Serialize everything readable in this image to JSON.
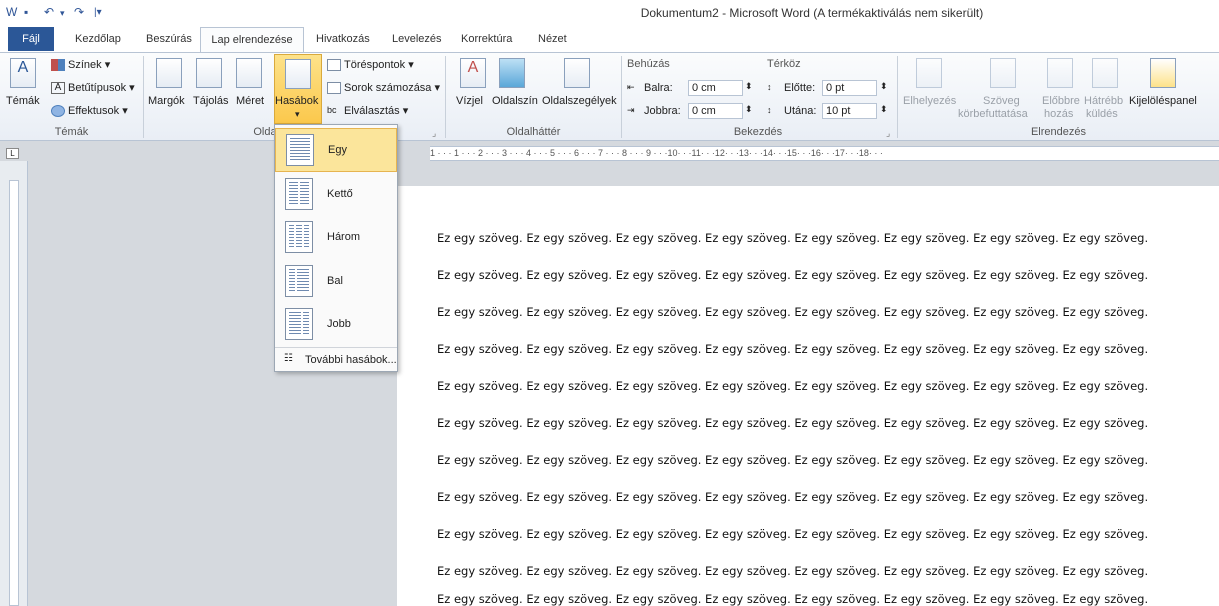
{
  "window": {
    "title": "Dokumentum2 - Microsoft Word (A termékaktiválás nem sikerült)"
  },
  "tabs": {
    "file": "Fájl",
    "home": "Kezdőlap",
    "insert": "Beszúrás",
    "layout": "Lap elrendezése",
    "references": "Hivatkozás",
    "mailings": "Levelezés",
    "review": "Korrektúra",
    "view": "Nézet"
  },
  "ribbon": {
    "themes": {
      "label": "Témák",
      "colors": "Színek",
      "fonts": "Betűtípusok",
      "effects": "Effektusok",
      "group": "Témák"
    },
    "pagesetup": {
      "margins": "Margók",
      "orientation": "Tájolás",
      "size": "Méret",
      "columns": "Hasábok",
      "breaks": "Töréspontok",
      "line_numbers": "Sorok számozása",
      "hyphenation": "Elválasztás",
      "group": "Olda"
    },
    "background": {
      "watermark": "Vízjel",
      "page_color": "Oldalszín",
      "page_borders": "Oldalszegélyek",
      "group": "Oldalháttér"
    },
    "paragraph": {
      "indent": "Behúzás",
      "left": "Balra:",
      "left_val": "0 cm",
      "right": "Jobbra:",
      "right_val": "0 cm",
      "spacing": "Térköz",
      "before": "Előtte:",
      "before_val": "0 pt",
      "after": "Utána:",
      "after_val": "10 pt",
      "group": "Bekezdés"
    },
    "arrange": {
      "position": "Elhelyezés",
      "wrap1": "Szöveg",
      "wrap2": "körbefuttatása",
      "forward1": "Előbbre",
      "forward2": "hozás",
      "backward1": "Hátrébb",
      "backward2": "küldés",
      "selection": "Kijelöléspanel",
      "group": "Elrendezés"
    }
  },
  "ruler": {
    "corner": "L",
    "marks": "1 · · · 1 · · · 2 · · · 3 · · · 4 · · · 5 · · · 6 · · · 7 · · · 8 · · · 9 · · ·10· · ·11· · ·12· · ·13· · ·14· · ·15· · ·16· · ·17· · ·18· · ·"
  },
  "columns_menu": {
    "items": [
      "Egy",
      "Kettő",
      "Három",
      "Bal",
      "Jobb"
    ],
    "more": "További hasábok..."
  },
  "document": {
    "line": "Ez egy szöveg. Ez egy szöveg. Ez egy szöveg. Ez egy szöveg. Ez egy szöveg. Ez egy szöveg. Ez egy szöveg. Ez egy szöveg."
  }
}
